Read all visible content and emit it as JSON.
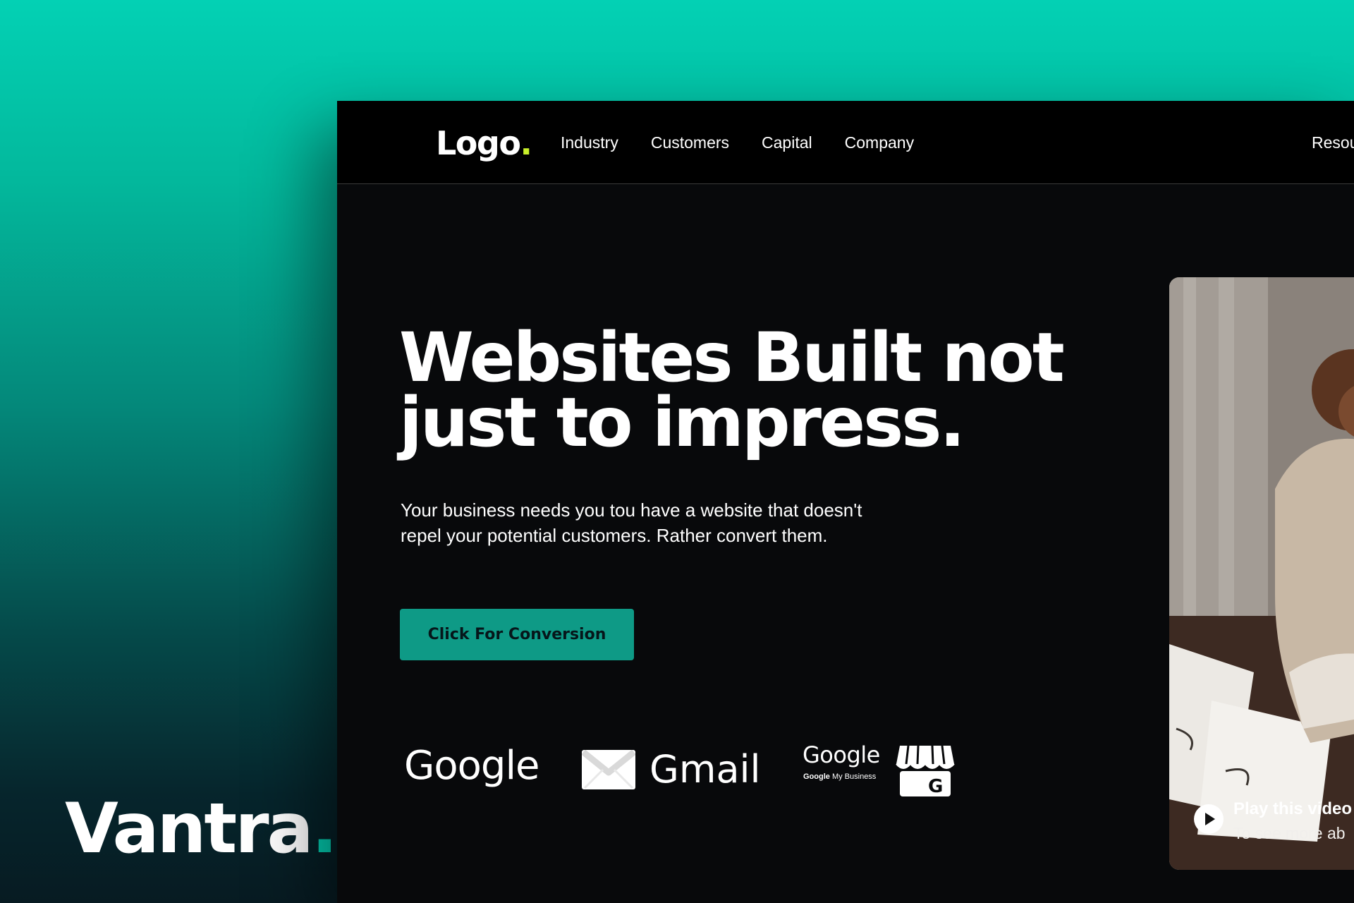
{
  "brand": {
    "name": "Vantra",
    "dot": "."
  },
  "colors": {
    "accent": "#03d1b4",
    "logo_dot": "#c8f02a",
    "cta_bg": "#0e9a86",
    "window_bg": "#08090b"
  },
  "nav": {
    "logo_text": "Logo",
    "logo_dot": ".",
    "items": [
      {
        "label": "Industry"
      },
      {
        "label": "Customers"
      },
      {
        "label": "Capital"
      },
      {
        "label": "Company"
      }
    ],
    "right_label": "Resou"
  },
  "hero": {
    "headline_line1": "Websites Built not",
    "headline_line2": "just to impress.",
    "sub_line1": "Your business needs you tou have a website that doesn't",
    "sub_line2": "repel your potential customers. Rather convert them.",
    "cta_label": "Click For Conversion"
  },
  "partner_logos": {
    "google": "Google",
    "gmail": "Gmail",
    "gmb_title": "Google",
    "gmb_sub_bold": "Google",
    "gmb_sub_rest": "My Business",
    "icons": [
      "gmail-envelope-icon",
      "google-my-business-store-icon"
    ]
  },
  "video": {
    "title": "Play this video",
    "subtitle": "To see more ab",
    "icon": "play-icon"
  }
}
